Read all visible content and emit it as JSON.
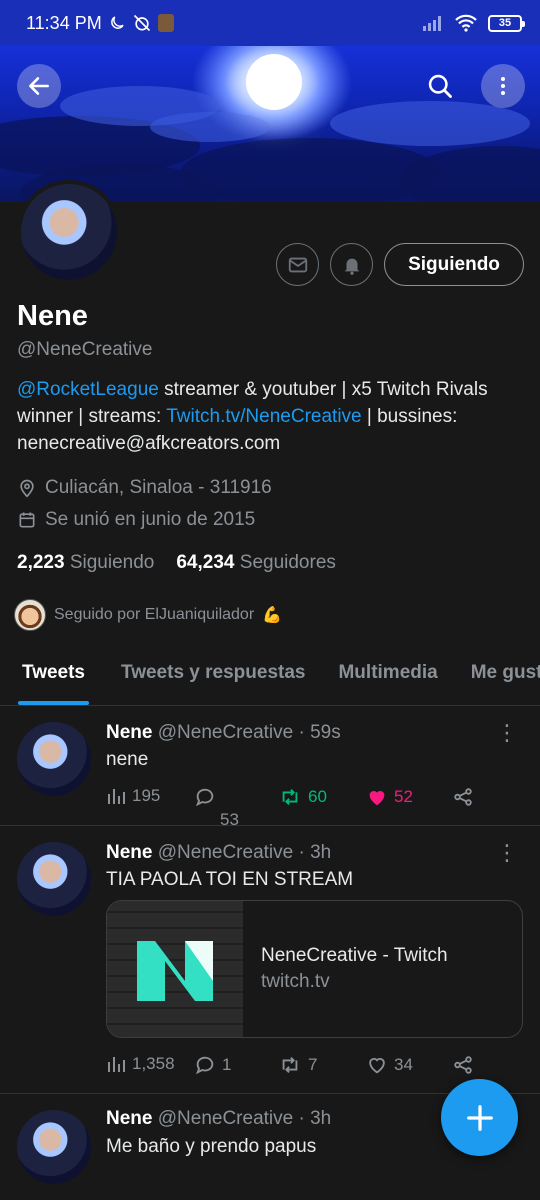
{
  "status_bar": {
    "time": "11:34 PM",
    "battery": "35"
  },
  "profile": {
    "name": "Nene",
    "handle": "@NeneCreative",
    "follow_label": "Siguiendo",
    "bio": {
      "mention": "@RocketLeague",
      "part1": " streamer & youtuber | x5 Twitch Rivals winner | streams: ",
      "link": "Twitch.tv/NeneCreative",
      "part2": " | bussines: nenecreative@afkcreators.com"
    },
    "location": "Culiacán, Sinaloa - 311916",
    "joined": "Se unió en junio de 2015",
    "following_count": "2,223",
    "following_label": "Siguiendo",
    "followers_count": "64,234",
    "followers_label": "Seguidores",
    "followed_by": "Seguido por ElJuaniquilador",
    "followed_by_emoji": "💪"
  },
  "tabs": [
    "Tweets",
    "Tweets y respuestas",
    "Multimedia",
    "Me gusta"
  ],
  "tweets": [
    {
      "name": "Nene",
      "handle": "@NeneCreative",
      "time": "· 59s",
      "text": "nene",
      "views": "195",
      "replies": "53",
      "retweets": "60",
      "likes": "52"
    },
    {
      "name": "Nene",
      "handle": "@NeneCreative",
      "time": "· 3h",
      "text": "TIA PAOLA TOI EN STREAM",
      "card_title": "NeneCreative - Twitch",
      "card_domain": "twitch.tv",
      "views": "1,358",
      "replies": "1",
      "retweets": "7",
      "likes": "34"
    },
    {
      "name": "Nene",
      "handle": "@NeneCreative",
      "time": "· 3h",
      "text": "Me baño y prendo papus"
    }
  ],
  "colors": {
    "accent": "#1d9bf0",
    "retweet": "#00ba7c",
    "like": "#f91880",
    "background": "#181818"
  }
}
